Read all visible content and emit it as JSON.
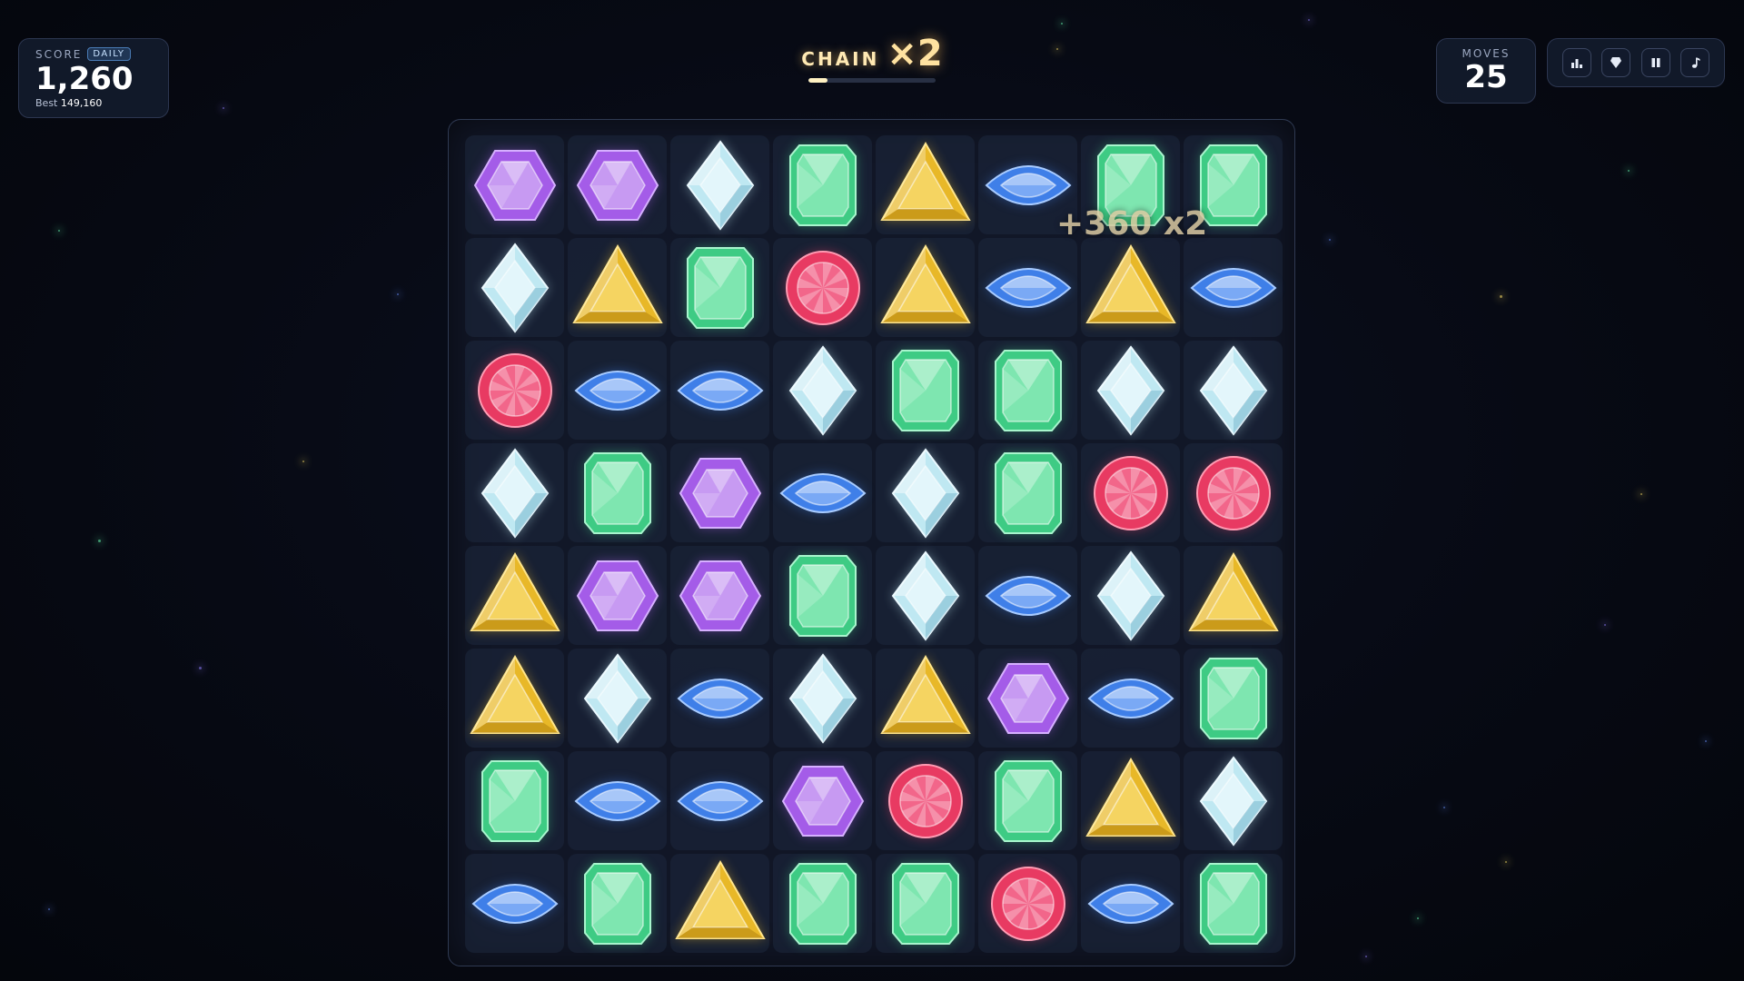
{
  "hud": {
    "score_label": "SCORE",
    "daily_badge": "DAILY",
    "score_value": "1,260",
    "best_label": "Best",
    "best_value": "149,160",
    "chain_label": "CHAIN",
    "chain_multiplier": "×2",
    "chain_progress": 0.15,
    "moves_label": "MOVES",
    "moves_value": "25"
  },
  "toolbar": {
    "buttons": [
      {
        "icon": "leaderboard-icon"
      },
      {
        "icon": "gem-icon"
      },
      {
        "icon": "pause-icon"
      },
      {
        "icon": "music-note-icon"
      }
    ]
  },
  "floating_score": {
    "text": "+360  x2"
  },
  "gem_colors": {
    "purple": "#a45ce8",
    "diamond": "#bfe8f2",
    "green": "#3ecb84",
    "yellow": "#e8b828",
    "blue": "#3f7fe8",
    "red": "#e83a62"
  },
  "board": [
    [
      "purple",
      "purple",
      "diamond",
      "green",
      "yellow",
      "blue",
      "green",
      "green"
    ],
    [
      "diamond",
      "yellow",
      "green",
      "red",
      "yellow",
      "blue",
      "yellow",
      "blue"
    ],
    [
      "red",
      "blue",
      "blue",
      "diamond",
      "green",
      "green",
      "diamond",
      "diamond"
    ],
    [
      "diamond",
      "green",
      "purple",
      "blue",
      "diamond",
      "green",
      "red",
      "red"
    ],
    [
      "yellow",
      "purple",
      "purple",
      "green",
      "diamond",
      "blue",
      "diamond",
      "yellow"
    ],
    [
      "yellow",
      "diamond",
      "blue",
      "diamond",
      "yellow",
      "purple",
      "blue",
      "green"
    ],
    [
      "green",
      "blue",
      "blue",
      "purple",
      "red",
      "green",
      "yellow",
      "diamond"
    ],
    [
      "blue",
      "green",
      "yellow",
      "green",
      "green",
      "red",
      "blue",
      "green"
    ]
  ]
}
